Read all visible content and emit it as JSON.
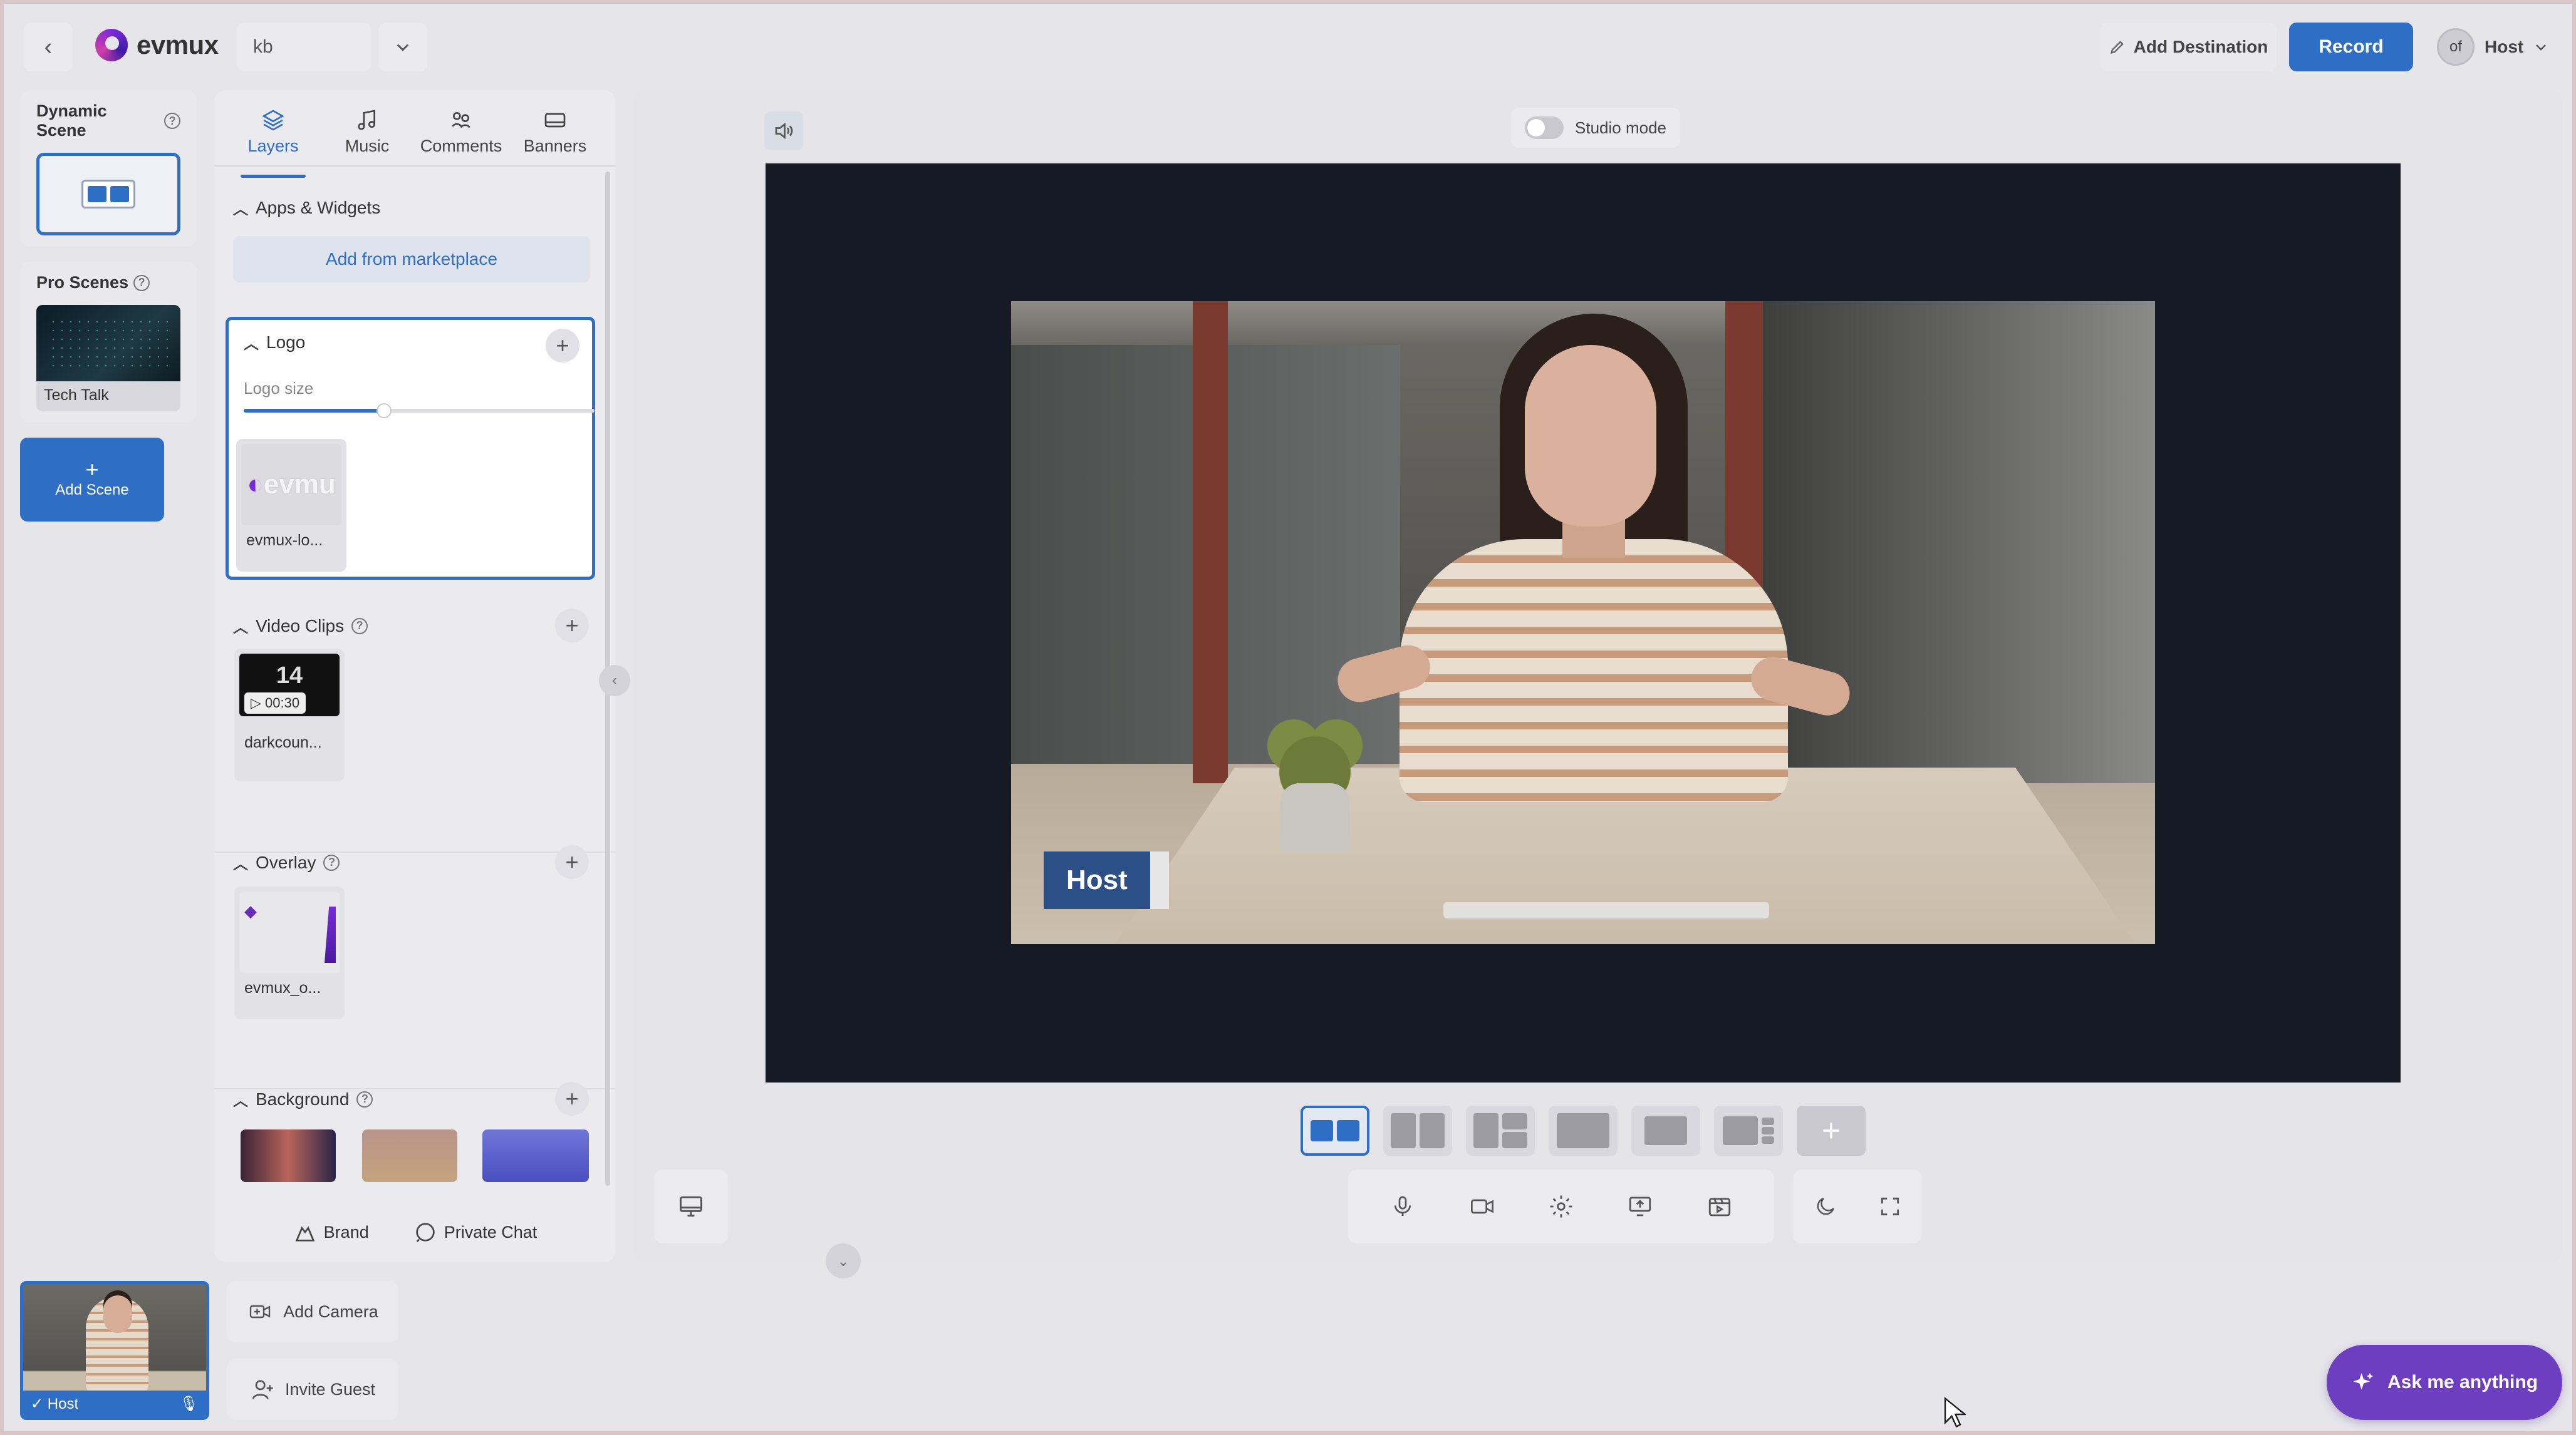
{
  "header": {
    "app_name": "evmux",
    "workspace": "kb",
    "add_destination": "Add Destination",
    "record": "Record",
    "avatar_text": "of",
    "user": "Host"
  },
  "scenes": {
    "dynamic_title": "Dynamic Scene",
    "pro_title": "Pro Scenes",
    "pro_items": [
      "Tech Talk"
    ],
    "add_scene": "Add Scene"
  },
  "panel": {
    "tabs": [
      "Layers",
      "Music",
      "Comments",
      "Banners"
    ],
    "active_tab": "Layers",
    "apps_title": "Apps & Widgets",
    "marketplace": "Add from marketplace",
    "logo_title": "Logo",
    "logo_size_label": "Logo size",
    "logo_size_value": 0.4,
    "logo_asset": "evmux-lo...",
    "logo_thumb_text": "evmu",
    "video_title": "Video Clips",
    "video_asset": "darkcoun...",
    "video_duration": "00:30",
    "video_thumb_text": "14",
    "overlay_title": "Overlay",
    "overlay_asset": "evmux_o...",
    "background_title": "Background",
    "brand": "Brand",
    "private_chat": "Private Chat"
  },
  "stage": {
    "studio_mode": "Studio mode",
    "name_tag": "Host",
    "layouts_count": 7,
    "active_layout_index": 0
  },
  "bottom": {
    "host_label": "Host",
    "add_camera": "Add Camera",
    "invite_guest": "Invite Guest",
    "ask": "Ask me anything"
  },
  "colors": {
    "accent": "#2e6fc5",
    "ask_purple": "#6d3fc0",
    "name_tag": "#2b4f86"
  }
}
